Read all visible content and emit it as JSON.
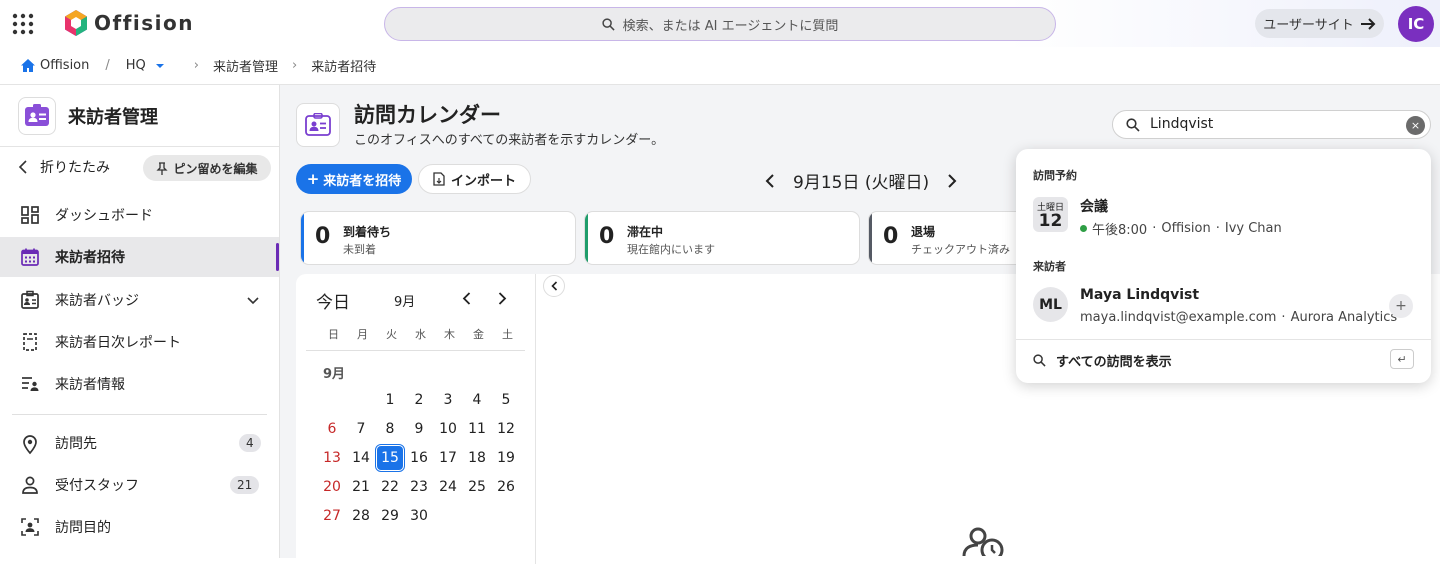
{
  "topbar": {
    "logo_text": "Offision",
    "search_placeholder": "検索、または AI エージェントに質問",
    "user_site_label": "ユーザーサイト",
    "avatar_initials": "IC"
  },
  "breadcrumb": {
    "home": "Offision",
    "location": "HQ",
    "section": "来訪者管理",
    "page": "来訪者招待"
  },
  "sidebar": {
    "title": "来訪者管理",
    "collapse_label": "折りたたみ",
    "pin_edit_label": "ピン留めを編集",
    "items": [
      {
        "label": "ダッシュボード",
        "icon": "dashboard-icon"
      },
      {
        "label": "来訪者招待",
        "icon": "calendar-icon",
        "active": true
      },
      {
        "label": "来訪者バッジ",
        "icon": "badge-icon"
      },
      {
        "label": "来訪者日次レポート",
        "icon": "report-icon"
      },
      {
        "label": "来訪者情報",
        "icon": "info-list-icon"
      },
      {
        "label": "訪問先",
        "icon": "location-icon",
        "count": "4"
      },
      {
        "label": "受付スタッフ",
        "icon": "person-icon",
        "count": "21"
      },
      {
        "label": "訪問目的",
        "icon": "purpose-icon"
      }
    ]
  },
  "header": {
    "title": "訪問カレンダー",
    "subtitle": "このオフィスへのすべての来訪者を示すカレンダー。",
    "invite_button": "来訪者を招待",
    "import_button": "インポート",
    "current_date": "9月15日 (火曜日)"
  },
  "stats": [
    {
      "value": "0",
      "title": "到着待ち",
      "subtitle": "未到着",
      "color": "#1a73e8"
    },
    {
      "value": "0",
      "title": "滞在中",
      "subtitle": "現在館内にいます",
      "color": "#1f9d6b"
    },
    {
      "value": "0",
      "title": "退場",
      "subtitle": "チェックアウト済み",
      "color": "#555a64"
    }
  ],
  "mini_calendar": {
    "today_label": "今日",
    "month_label": "9月",
    "section_month": "9月",
    "weekdays": [
      "日",
      "月",
      "火",
      "水",
      "木",
      "金",
      "土"
    ],
    "selected_day": "15",
    "first_weekday": 2,
    "days": [
      "1",
      "2",
      "3",
      "4",
      "5",
      "6",
      "7",
      "8",
      "9",
      "10",
      "11",
      "12",
      "13",
      "14",
      "15",
      "16",
      "17",
      "18",
      "19",
      "20",
      "21",
      "22",
      "23",
      "24",
      "25",
      "26",
      "27",
      "28",
      "29",
      "30"
    ]
  },
  "visitor_search": {
    "value": "Lindqvist",
    "clear_label": "×"
  },
  "popover": {
    "section_appointments": "訪問予約",
    "appointment": {
      "weekday": "土曜日",
      "day": "12",
      "title": "会議",
      "time": "午後8:00",
      "location": "Offision",
      "host": "Ivy Chan",
      "status_color": "#2e9e45"
    },
    "section_visitors": "来訪者",
    "visitor": {
      "initials": "ML",
      "name": "Maya Lindqvist",
      "email": "maya.lindqvist@example.com",
      "company": "Aurora Analytics"
    },
    "show_all_label": "すべての訪問を表示",
    "enter_key": "↵"
  },
  "colors": {
    "accent": "#1a73e8",
    "brand_purple": "#7a2fbf",
    "sunday_red": "#c62828"
  }
}
